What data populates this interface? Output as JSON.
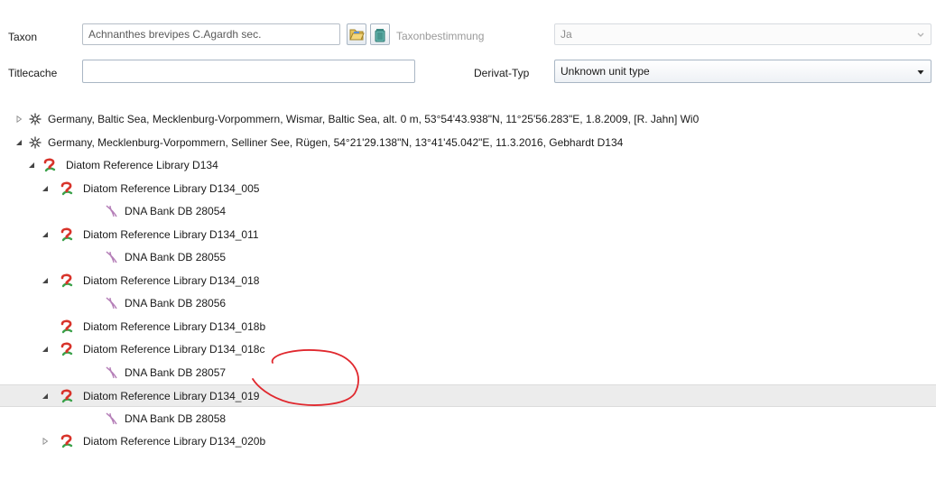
{
  "form": {
    "taxon_label": "Taxon",
    "taxon_value": "Achnanthes brevipes C.Agardh sec.",
    "taxonbestimmung_label": "Taxonbestimmung",
    "taxonbestimmung_value": "Ja",
    "titlecache_label": "Titlecache",
    "titlecache_value": "",
    "derivat_label": "Derivat-Typ",
    "derivat_value": "Unknown unit type"
  },
  "colors": {
    "annotation": "#e0282e",
    "specimen_icon_red": "#d8332a",
    "specimen_icon_green": "#3aa14a",
    "dna_icon": "#b57fb8"
  },
  "tree": [
    {
      "level": 0,
      "icon": "field-unit-icon",
      "twisty": "collapsed",
      "label": "Germany, Baltic Sea, Mecklenburg-Vorpommern, Wismar, Baltic Sea, alt. 0 m, 53°54'43.938\"N, 11°25'56.283\"E, 1.8.2009, [R. Jahn] Wi0"
    },
    {
      "level": 0,
      "icon": "field-unit-icon",
      "twisty": "expanded",
      "label": "Germany, Mecklenburg-Vorpommern, Selliner See, Rügen, 54°21'29.138\"N, 13°41'45.042\"E, 11.3.2016, Gebhardt D134"
    },
    {
      "level": 1,
      "icon": "specimen-icon",
      "twisty": "expanded",
      "label": "Diatom Reference Library D134"
    },
    {
      "level": 2,
      "icon": "specimen-icon",
      "twisty": "expanded",
      "label": "Diatom Reference Library D134_005"
    },
    {
      "level": 3,
      "icon": "dna-icon",
      "twisty": "none",
      "label": "DNA Bank DB 28054"
    },
    {
      "level": 2,
      "icon": "specimen-icon",
      "twisty": "expanded",
      "label": "Diatom Reference Library D134_011"
    },
    {
      "level": 3,
      "icon": "dna-icon",
      "twisty": "none",
      "label": "DNA Bank DB 28055"
    },
    {
      "level": 2,
      "icon": "specimen-icon",
      "twisty": "expanded",
      "label": "Diatom Reference Library D134_018"
    },
    {
      "level": 3,
      "icon": "dna-icon",
      "twisty": "none",
      "label": "DNA Bank DB 28056"
    },
    {
      "level": 2,
      "icon": "specimen-icon",
      "twisty": "none",
      "label": "Diatom Reference Library D134_018b"
    },
    {
      "level": 2,
      "icon": "specimen-icon",
      "twisty": "expanded",
      "label": "Diatom Reference Library D134_018c"
    },
    {
      "level": 3,
      "icon": "dna-icon",
      "twisty": "none",
      "label": "DNA Bank DB 28057"
    },
    {
      "level": 2,
      "icon": "specimen-icon",
      "twisty": "expanded",
      "label": "Diatom Reference Library D134_019",
      "selected": true
    },
    {
      "level": 3,
      "icon": "dna-icon",
      "twisty": "none",
      "label": "DNA Bank DB 28058"
    },
    {
      "level": 2,
      "icon": "specimen-icon",
      "twisty": "collapsed",
      "label": "Diatom Reference Library D134_020b"
    }
  ]
}
